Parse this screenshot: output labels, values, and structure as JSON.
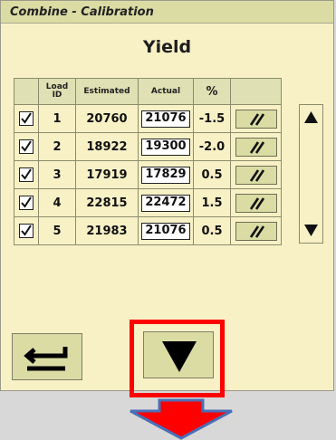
{
  "window": {
    "title": "Combine - Calibration"
  },
  "screen": {
    "heading": "Yield"
  },
  "table": {
    "headers": {
      "load_id_line1": "Load",
      "load_id_line2": "ID",
      "estimated": "Estimated",
      "actual": "Actual",
      "percent": "%"
    },
    "rows": [
      {
        "checked": true,
        "id": "1",
        "estimated": "20760",
        "actual": "21076",
        "percent": "-1.5"
      },
      {
        "checked": true,
        "id": "2",
        "estimated": "18922",
        "actual": "19300",
        "percent": "-2.0"
      },
      {
        "checked": true,
        "id": "3",
        "estimated": "17919",
        "actual": "17829",
        "percent": "0.5"
      },
      {
        "checked": true,
        "id": "4",
        "estimated": "22815",
        "actual": "22472",
        "percent": "1.5"
      },
      {
        "checked": true,
        "id": "5",
        "estimated": "21983",
        "actual": "21076",
        "percent": "0.5"
      }
    ]
  },
  "icons": {
    "edit": "edit-slash-icon",
    "scroll_up": "triangle-up-icon",
    "scroll_down": "triangle-down-icon",
    "back": "back-arrow-icon",
    "page_down": "triangle-down-icon",
    "callout": "blue-down-arrow-icon"
  },
  "colors": {
    "panel_background": "#f8f1c6",
    "button_background": "#dadca4",
    "highlight_border": "#ff0000",
    "callout_arrow_fill": "#ff0000",
    "callout_arrow_outline": "#4a6fb8"
  }
}
